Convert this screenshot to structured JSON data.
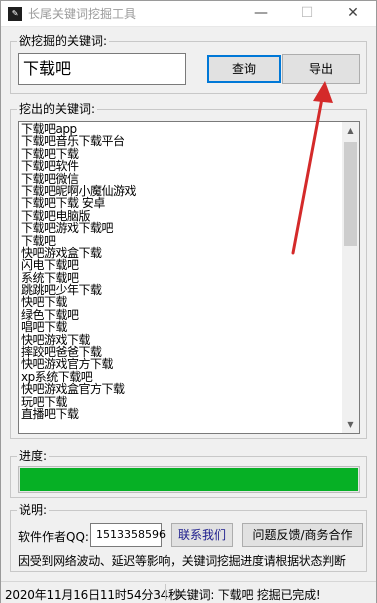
{
  "window": {
    "title": "长尾关键词挖掘工具",
    "icon": "app-icon",
    "controls": {
      "minimize": "—",
      "maximize": "☐",
      "close": "✕"
    }
  },
  "keyword_group": {
    "label": "欲挖掘的关键词:",
    "input_value": "下载吧",
    "query_button": "查询",
    "export_button": "导出"
  },
  "result_group": {
    "label": "挖出的关键词:",
    "items": [
      "下载吧app",
      "下载吧音乐下载平台",
      "下载吧下载",
      "下载吧软件",
      "下载吧微信",
      "下载吧昵啊小魔仙游戏",
      "下载吧下载 安卓",
      "下载吧电脑版",
      "下载吧游戏下载吧",
      "下载吧",
      "快吧游戏盒下载",
      "闪电下载吧",
      "系统下载吧",
      "跳跳吧少年下载",
      "快吧下载",
      "绿色下载吧",
      "唱吧下载",
      "快吧游戏下载",
      "摔跤吧爸爸下载",
      "快吧游戏官方下载",
      "xp系统下载吧",
      "快吧游戏盒官方下载",
      "玩吧下载",
      "直播吧下载"
    ]
  },
  "progress_group": {
    "label": "进度:",
    "percent": 100,
    "bar_color": "#06b025"
  },
  "note_group": {
    "label": "说明:",
    "author_label": "软件作者QQ:",
    "qq_value": "1513358596",
    "contact_button": "联系我们",
    "feedback_button": "问题反馈/商务合作",
    "notice": "因受到网络波动、延迟等影响，关键词挖掘进度请根据状态判断"
  },
  "statusbar": {
    "datetime": "2020年11月16日11时54分34秒",
    "message": "关键词: 下载吧 挖掘已完成!"
  },
  "annotation": {
    "arrow_color": "#d42a2a"
  }
}
